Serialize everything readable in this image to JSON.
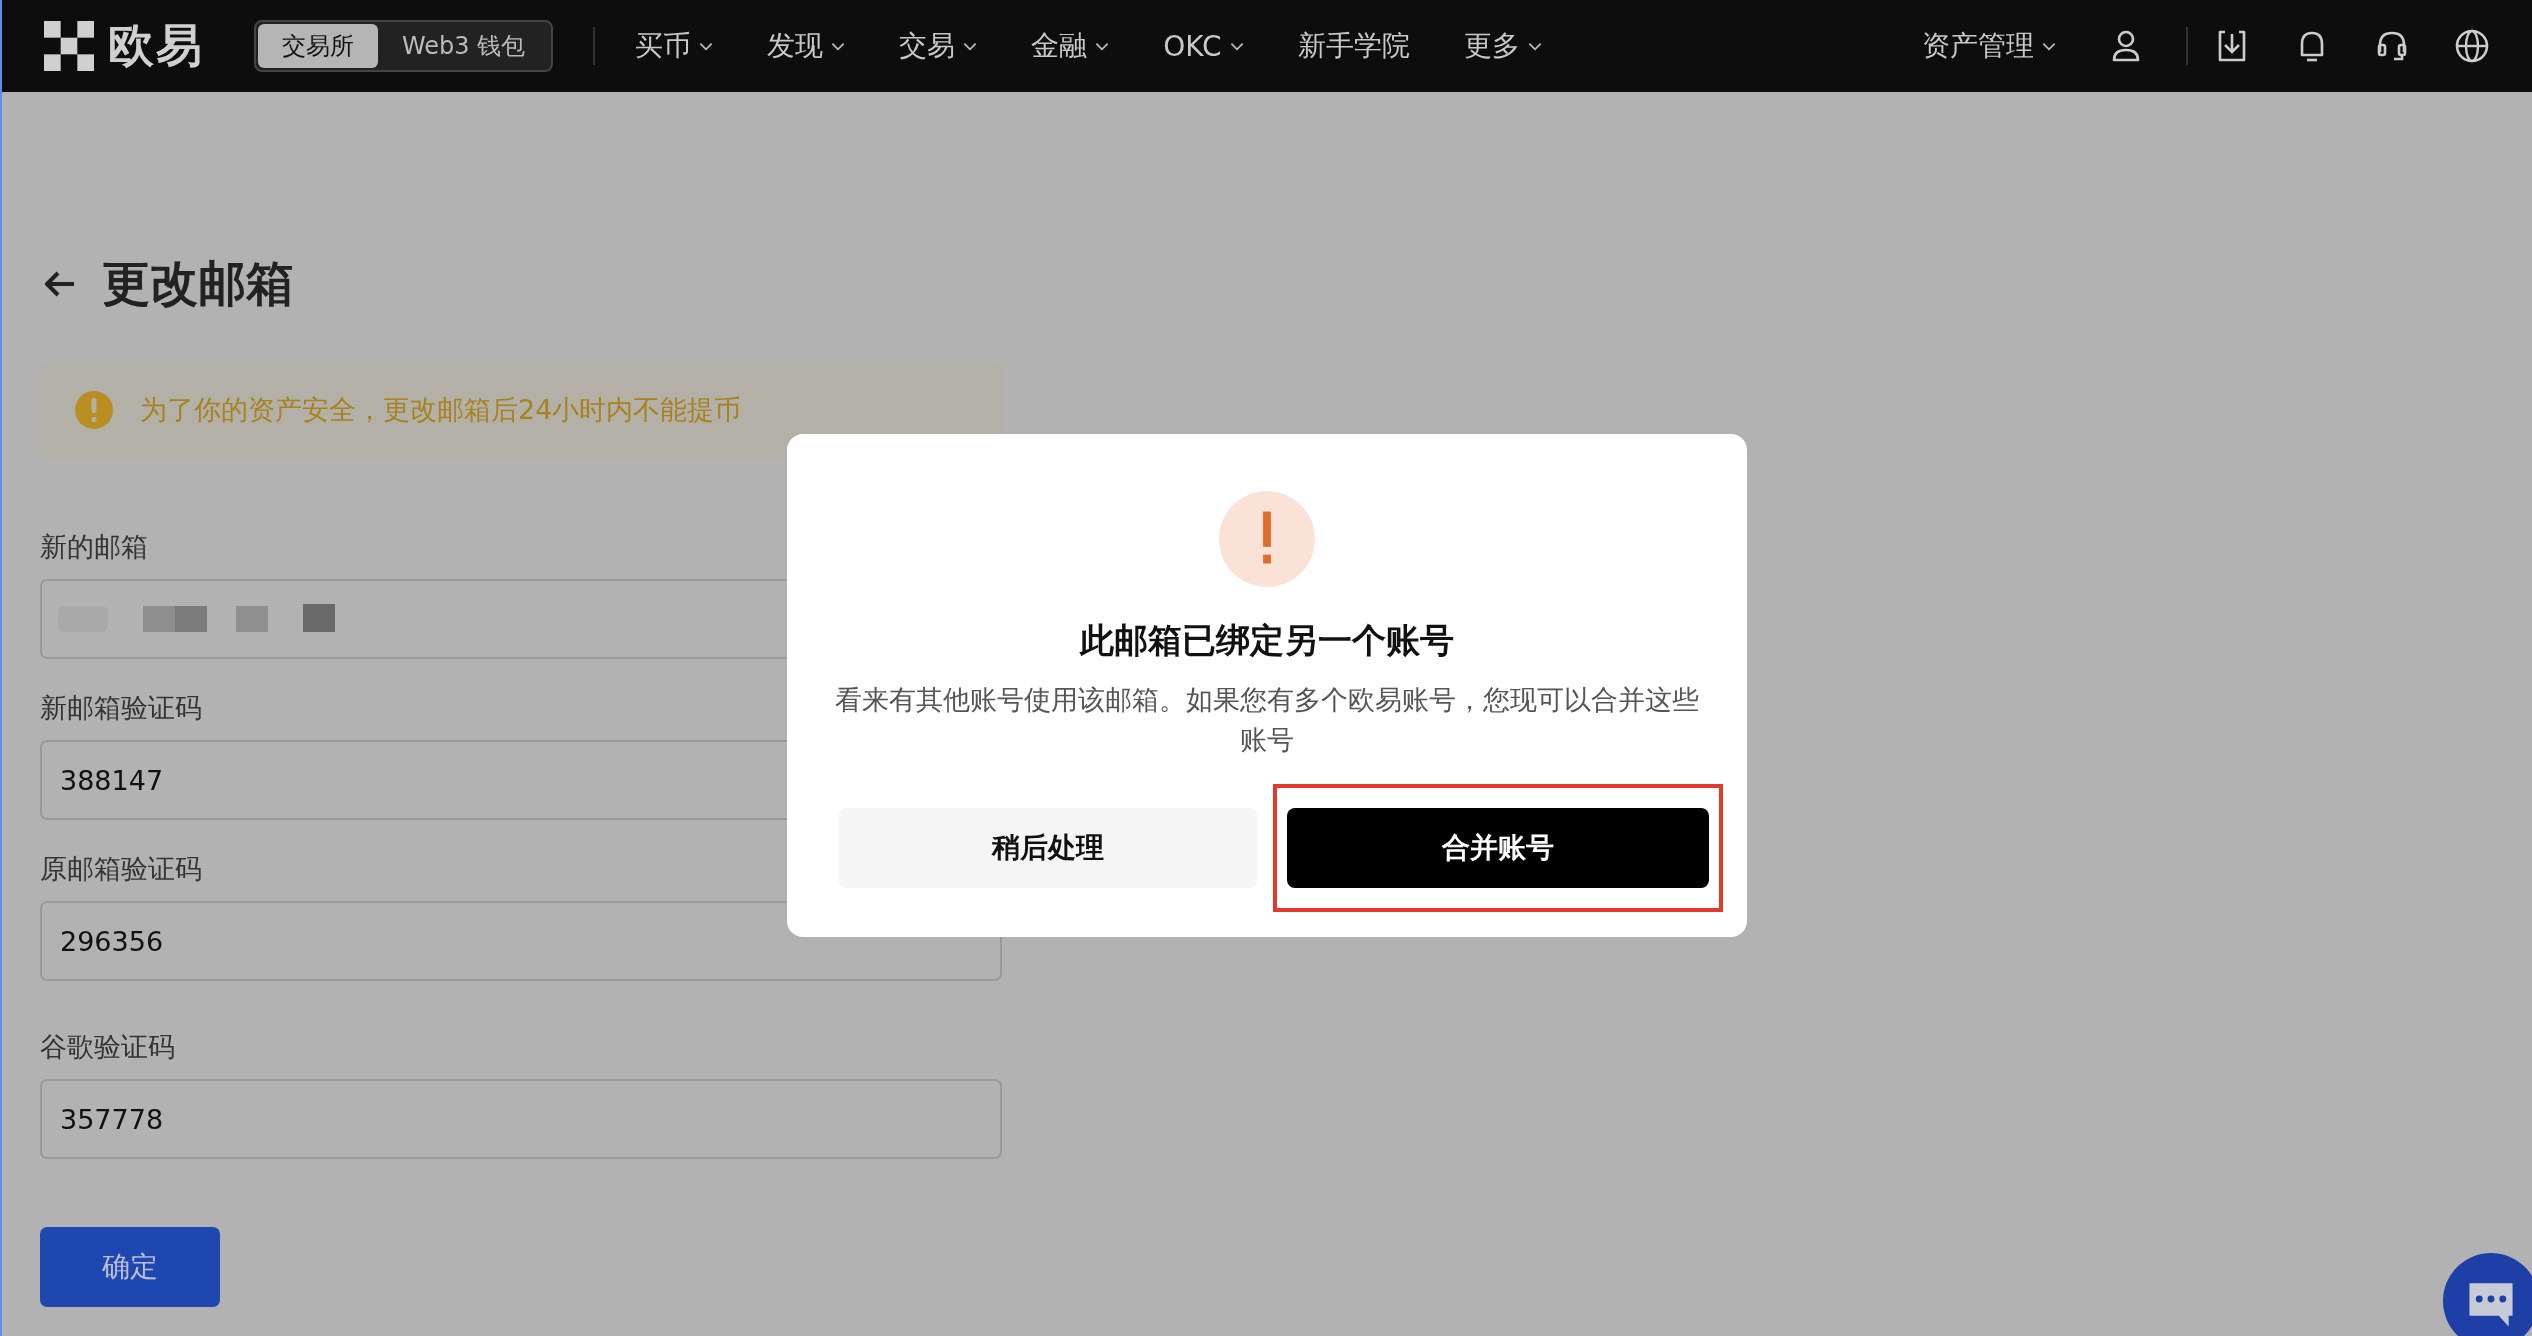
{
  "nav": {
    "logo_text": "欧易",
    "segments": [
      {
        "label": "交易所",
        "selected": true
      },
      {
        "label": "Web3 钱包",
        "selected": false
      }
    ],
    "menu": [
      {
        "label": "买币",
        "dropdown": true
      },
      {
        "label": "发现",
        "dropdown": true
      },
      {
        "label": "交易",
        "dropdown": true
      },
      {
        "label": "金融",
        "dropdown": true
      },
      {
        "label": "OKC",
        "dropdown": true
      },
      {
        "label": "新手学院",
        "dropdown": false
      },
      {
        "label": "更多",
        "dropdown": true
      }
    ],
    "asset_menu": {
      "label": "资产管理",
      "dropdown": true
    }
  },
  "page": {
    "title": "更改邮箱",
    "alert": "为了你的资产安全，更改邮箱后24小时内不能提币",
    "fields": [
      {
        "label": "新的邮箱",
        "kind": "masked"
      },
      {
        "label": "新邮箱验证码",
        "kind": "text",
        "value": "388147"
      },
      {
        "label": "原邮箱验证码",
        "kind": "text",
        "value": "296356"
      },
      {
        "label": "谷歌验证码",
        "kind": "text",
        "value": "357778"
      }
    ],
    "submit": "确定"
  },
  "modal": {
    "title": "此邮箱已绑定另一个账号",
    "message": "看来有其他账号使用该邮箱。如果您有多个欧易账号，您现可以合并这些账号",
    "buttons": [
      {
        "label": "稍后处理",
        "kind": "secondary",
        "highlighted": false
      },
      {
        "label": "合并账号",
        "kind": "primary",
        "highlighted": true
      }
    ]
  }
}
